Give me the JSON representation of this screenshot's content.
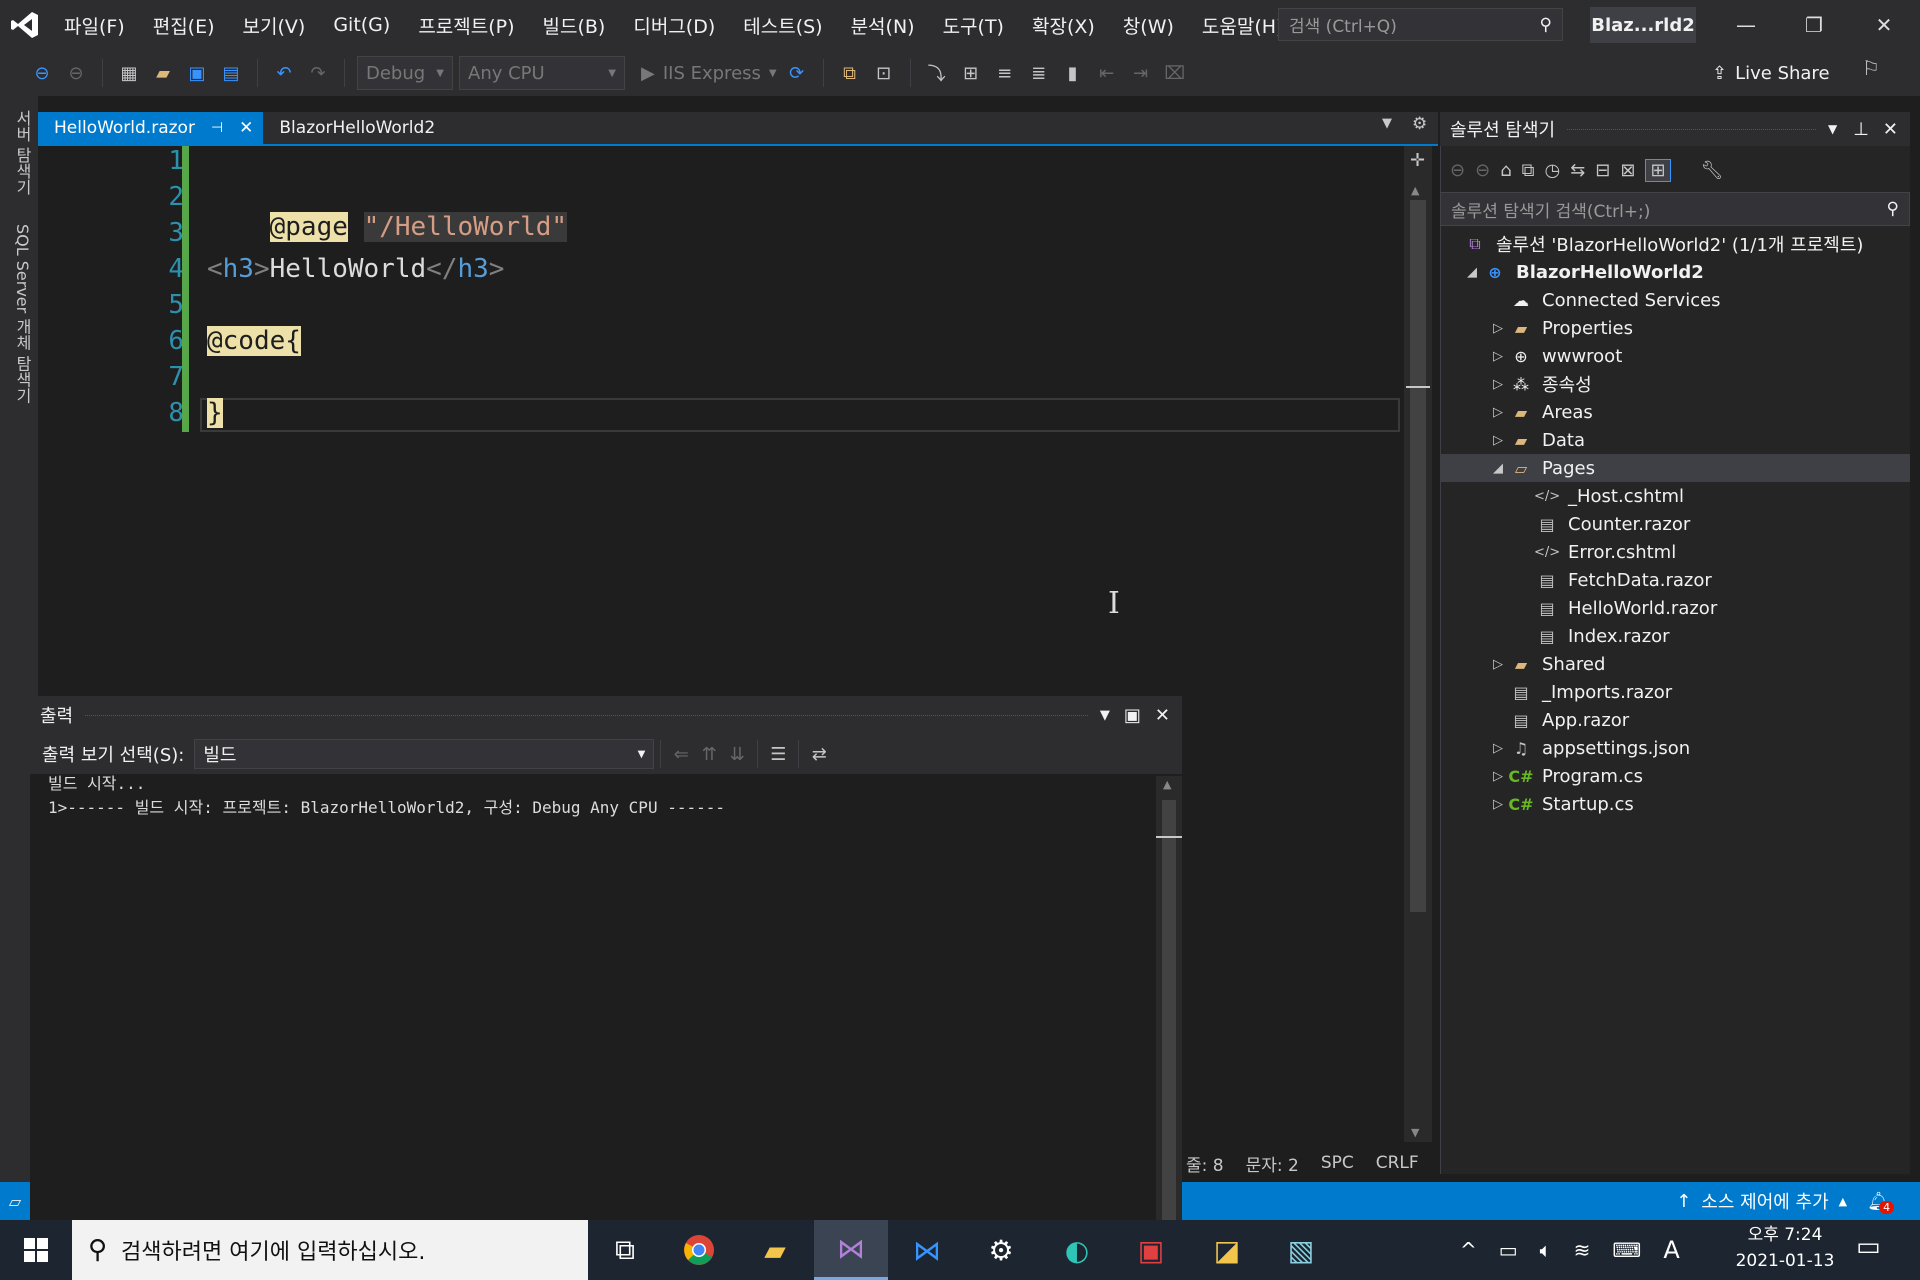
{
  "titlebar": {
    "menu": [
      "파일(F)",
      "편집(E)",
      "보기(V)",
      "Git(G)",
      "프로젝트(P)",
      "빌드(B)",
      "디버그(D)",
      "테스트(S)",
      "분석(N)",
      "도구(T)",
      "확장(X)",
      "창(W)",
      "도움말(H)"
    ],
    "search_placeholder": "검색 (Ctrl+Q)",
    "window_title": "Blaz...rld2"
  },
  "toolbar": {
    "config": "Debug",
    "platform": "Any CPU",
    "run_target": "IIS Express",
    "live_share": "Live Share"
  },
  "leftstrip": {
    "server_explorer": "서버 탐색기",
    "sql_explorer": "SQL Server 개체 탐색기"
  },
  "tabs": {
    "active": "HelloWorld.razor",
    "pin": "⊣",
    "inactive": "BlazorHelloWorld2"
  },
  "editor": {
    "line_numbers": [
      "1",
      "2",
      "3",
      "4",
      "5",
      "6",
      "7",
      "8"
    ],
    "line2_directive": "@page",
    "line2_string": "\"/HelloWorld\"",
    "line4_open": "<",
    "line4_tag": "h3",
    "line4_close_bracket": ">",
    "line4_text": "HelloWorld",
    "line4_end_open": "</",
    "line4_end_tag": "h3",
    "line4_end_close": ">",
    "line6": "@code{",
    "line8": "}"
  },
  "output": {
    "title": "출력",
    "select_label": "출력 보기 선택(S):",
    "select_value": "빌드",
    "lines": [
      "빌드 시작...",
      "1>------ 빌드 시작: 프로젝트: BlazorHelloWorld2, 구성: Debug Any CPU ------"
    ]
  },
  "status": {
    "line": "줄: 8",
    "col": "문자: 2",
    "spc": "SPC",
    "crlf": "CRLF",
    "source_control": "소스 제어에 추가",
    "notifications": "4"
  },
  "solution_explorer": {
    "title": "솔루션 탐색기",
    "search_placeholder": "솔루션 탐색기 검색(Ctrl+;)",
    "solution": "솔루션 'BlazorHelloWorld2' (1/1개 프로젝트)",
    "project": "BlazorHelloWorld2",
    "items": {
      "connected": "Connected Services",
      "properties": "Properties",
      "wwwroot": "wwwroot",
      "deps": "종속성",
      "areas": "Areas",
      "data": "Data",
      "pages": "Pages",
      "host": "_Host.cshtml",
      "counter": "Counter.razor",
      "error": "Error.cshtml",
      "fetch": "FetchData.razor",
      "hello": "HelloWorld.razor",
      "index": "Index.razor",
      "shared": "Shared",
      "imports": "_Imports.razor",
      "app": "App.razor",
      "appsettings": "appsettings.json",
      "program": "Program.cs",
      "startup": "Startup.cs"
    }
  },
  "taskbar": {
    "search_placeholder": "검색하려면 여기에 입력하십시오.",
    "time": "오후 7:24",
    "date": "2021-01-13",
    "ime": "A"
  },
  "colors": {
    "accent": "#007acc",
    "background": "#1e1e1e",
    "chrome": "#2d2d30"
  }
}
